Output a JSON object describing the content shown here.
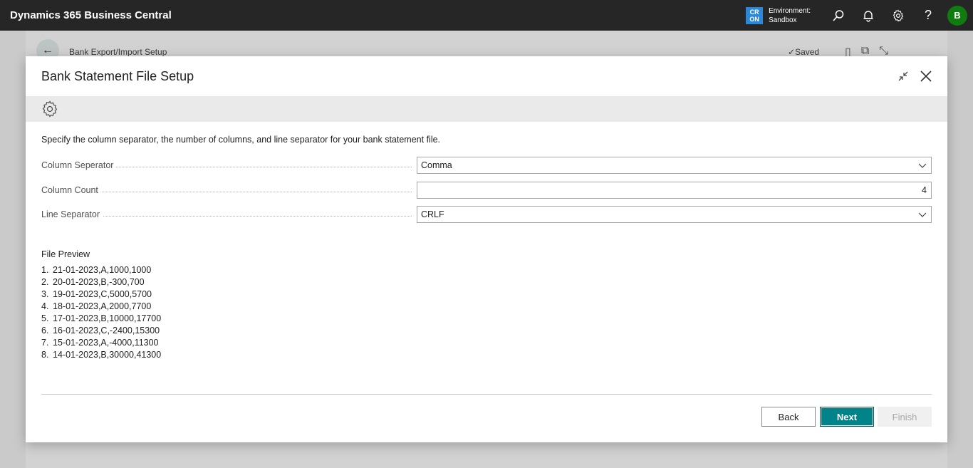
{
  "topbar": {
    "app_title": "Dynamics 365 Business Central",
    "env_badge": "CR ON",
    "env_badge_line1": "CR",
    "env_badge_line2": "ON",
    "env_label": "Environment:",
    "env_name": "Sandbox",
    "avatar_initial": "B",
    "icons": [
      "search-icon",
      "bell-icon",
      "gear-icon",
      "help-icon"
    ]
  },
  "background_page": {
    "title": "Bank Export/Import Setup",
    "saved_label": "Saved"
  },
  "dialog": {
    "title": "Bank Statement File Setup",
    "instruction": "Specify the column separator, the number of columns, and line separator for your bank statement file.",
    "fields": [
      {
        "label": "Column Seperator",
        "value": "Comma",
        "type": "dropdown"
      },
      {
        "label": "Column Count",
        "value": "4",
        "type": "number"
      },
      {
        "label": "Line Separator",
        "value": "CRLF",
        "type": "dropdown"
      }
    ],
    "preview_title": "File Preview",
    "preview_lines": [
      {
        "num": "1.",
        "text": "21-01-2023,A,1000,1000"
      },
      {
        "num": "2.",
        "text": "20-01-2023,B,-300,700"
      },
      {
        "num": "3.",
        "text": "19-01-2023,C,5000,5700"
      },
      {
        "num": "4.",
        "text": "18-01-2023,A,2000,7700"
      },
      {
        "num": "5.",
        "text": "17-01-2023,B,10000,17700"
      },
      {
        "num": "6.",
        "text": "16-01-2023,C,-2400,15300"
      },
      {
        "num": "7.",
        "text": "15-01-2023,A,-4000,11300"
      },
      {
        "num": "8.",
        "text": "14-01-2023,B,30000,41300"
      }
    ],
    "buttons": {
      "back": "Back",
      "next": "Next",
      "finish": "Finish"
    }
  },
  "colors": {
    "topbar_bg": "#262626",
    "accent": "#008489",
    "env_badge": "#2b88d8",
    "avatar": "#107c10"
  }
}
